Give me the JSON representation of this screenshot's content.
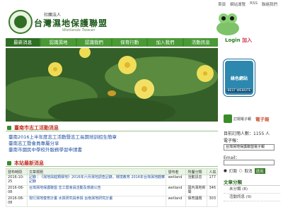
{
  "header": {
    "org_small": "社團法人",
    "org_title": "台灣濕地保護聯盟",
    "org_sub": "Wetlands Taiwan",
    "top_links": [
      "首頁",
      "網站導覽",
      "RSS",
      "聯絡我們"
    ],
    "login_label": "Login",
    "join_label": "加入"
  },
  "nav": {
    "items": [
      "最新消息",
      "認識濕地",
      "認識我們",
      "保育行動",
      "加入我們",
      "活動訊息"
    ]
  },
  "news": {
    "heading": "臺南市志工活動消息",
    "items": [
      "臺南2016上半年度志工活動暨志工長期培訓招生簡章",
      "臺南志工暨會員專屬分享",
      "臺南市國民中學校外服務學習申請書"
    ]
  },
  "latest": {
    "heading": "本站最新消息",
    "columns": [
      "發布時間",
      "文章標題",
      "發布者",
      "所屬分類",
      "人氣"
    ],
    "rows": [
      {
        "date": "2016-10-25",
        "title": "記錄｜《濕地與蛙類棲地》2016年六月濕地調查記錄，環境教育 2016年台灣濕地觀察記錄",
        "author": "wetland",
        "category": "活動訊息",
        "views": "177"
      },
      {
        "date": "2016-08-08",
        "title": "台灣濕地保護聯盟 志工暨會員活動及感謝公告",
        "author": "wetland",
        "category": "國內濕地新聞",
        "views": "346"
      },
      {
        "date": "2016-08-08",
        "title": "現行濕地復育計畫 水質研究員參與 台南濕地研究計畫",
        "author": "wetland",
        "category": "保育議題",
        "views": "303"
      }
    ]
  },
  "sidebar": {
    "badge_text": "綠色網站",
    "badge_sub": "BEST WEBSITE",
    "epaper_label": "訂閱電子報",
    "epaper_title": "電子報",
    "count_text": "目前訂閱人數：1155 人",
    "subscribe_label": "電子報：",
    "select_value": "台灣濕地保護聯盟電子報",
    "email_label": "Email：",
    "radio_subscribe": "訂閱",
    "radio_cancel": "取消",
    "submit_label": "送出",
    "category_title": "文章分類",
    "categories": [
      "未分類 (8)",
      "活動訊息 (9)"
    ]
  },
  "colors": {
    "nav_green": "#3d8a2e",
    "accent_red": "#c03020",
    "link_blue": "#1f4fa0"
  }
}
